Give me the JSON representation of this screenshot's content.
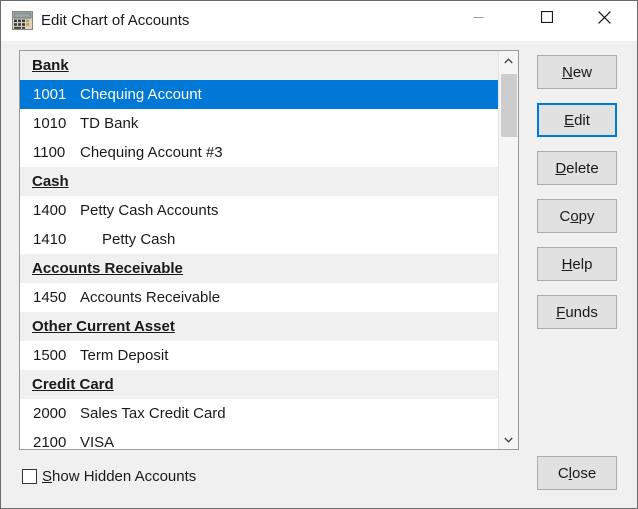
{
  "window": {
    "title": "Edit Chart of Accounts",
    "icon": "calculator-ledger-icon",
    "controls": {
      "minimize": "minimize-icon",
      "maximize": "maximize-icon",
      "close": "close-icon"
    },
    "background_color": "#f0f0f0",
    "accent_color": "#0078d7"
  },
  "list": {
    "selected_account_number": "1001",
    "rows": [
      {
        "type": "header",
        "label": "Bank"
      },
      {
        "type": "account",
        "number": "1001",
        "name": "Chequing Account",
        "indent": 1,
        "selected": true
      },
      {
        "type": "account",
        "number": "1010",
        "name": "TD Bank",
        "indent": 1,
        "selected": false
      },
      {
        "type": "account",
        "number": "1100",
        "name": "Chequing Account #3",
        "indent": 1,
        "selected": false
      },
      {
        "type": "header",
        "label": "Cash"
      },
      {
        "type": "account",
        "number": "1400",
        "name": "Petty Cash Accounts",
        "indent": 1,
        "selected": false
      },
      {
        "type": "account",
        "number": "1410",
        "name": "Petty Cash",
        "indent": 2,
        "selected": false
      },
      {
        "type": "header",
        "label": "Accounts Receivable"
      },
      {
        "type": "account",
        "number": "1450",
        "name": "Accounts Receivable",
        "indent": 1,
        "selected": false
      },
      {
        "type": "header",
        "label": "Other Current Asset"
      },
      {
        "type": "account",
        "number": "1500",
        "name": "Term Deposit",
        "indent": 1,
        "selected": false
      },
      {
        "type": "header",
        "label": "Credit Card"
      },
      {
        "type": "account",
        "number": "2000",
        "name": "Sales Tax Credit Card",
        "indent": 1,
        "selected": false
      },
      {
        "type": "account",
        "number": "2100",
        "name": "VISA",
        "indent": 1,
        "selected": false
      }
    ]
  },
  "scrollbar": {
    "up_icon": "chevron-up-icon",
    "down_icon": "chevron-down-icon",
    "thumb_color": "#cdcdcd"
  },
  "buttons": {
    "new": {
      "prefix": "",
      "accel": "N",
      "suffix": "ew"
    },
    "edit": {
      "prefix": "",
      "accel": "E",
      "suffix": "dit",
      "focused": true
    },
    "delete": {
      "prefix": "",
      "accel": "D",
      "suffix": "elete"
    },
    "copy": {
      "prefix": "C",
      "accel": "o",
      "suffix": "py"
    },
    "help": {
      "prefix": "",
      "accel": "H",
      "suffix": "elp"
    },
    "funds": {
      "prefix": "",
      "accel": "F",
      "suffix": "unds"
    },
    "close": {
      "prefix": "C",
      "accel": "l",
      "suffix": "ose"
    }
  },
  "checkbox": {
    "checked": false,
    "prefix": "",
    "accel": "S",
    "suffix": "how Hidden Accounts",
    "full_label": "Show Hidden Accounts"
  }
}
